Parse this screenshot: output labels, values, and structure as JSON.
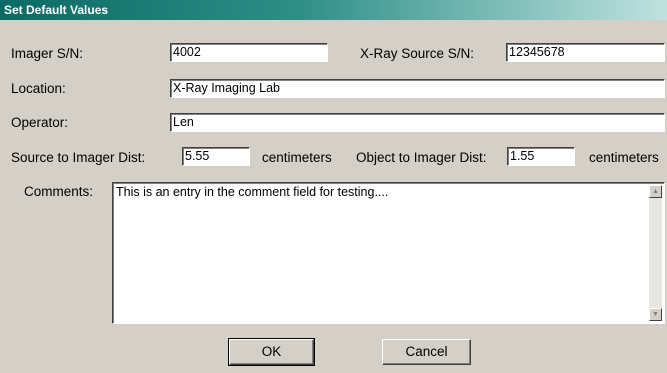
{
  "window": {
    "title": "Set Default Values"
  },
  "fields": {
    "imager_sn": {
      "label": "Imager S/N:",
      "value": "4002"
    },
    "xray_source_sn": {
      "label": "X-Ray Source S/N:",
      "value": "12345678"
    },
    "location": {
      "label": "Location:",
      "value": "X-Ray Imaging Lab"
    },
    "operator": {
      "label": "Operator:",
      "value": "Len"
    },
    "source_to_imager": {
      "label": "Source to Imager Dist:",
      "value": "5.55",
      "unit": "centimeters"
    },
    "object_to_imager": {
      "label": "Object to Imager Dist:",
      "value": "1.55",
      "unit": "centimeters"
    },
    "comments": {
      "label": "Comments:",
      "value": "This is an entry in the comment field for testing...."
    }
  },
  "icons": {
    "scroll_up": "scroll-up-arrow-icon",
    "scroll_down": "scroll-down-arrow-icon"
  },
  "buttons": {
    "ok": "OK",
    "cancel": "Cancel"
  }
}
